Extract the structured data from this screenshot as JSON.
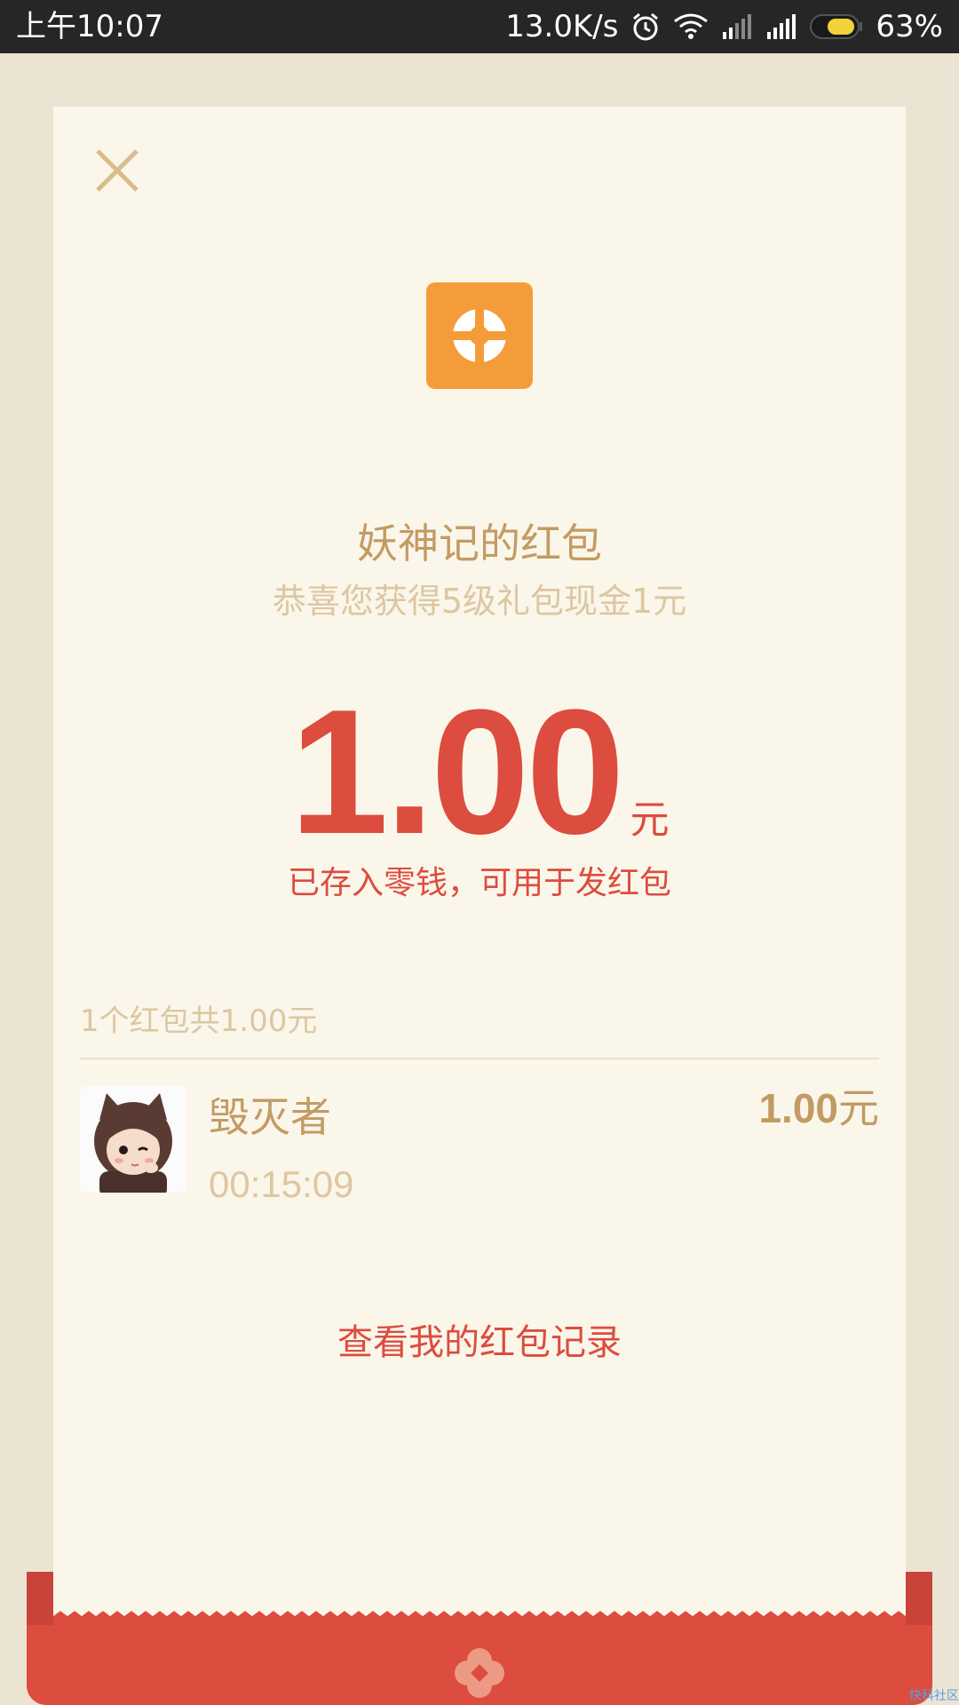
{
  "status_bar": {
    "time": "上午10:07",
    "network_speed": "13.0K/s",
    "battery": "63%",
    "icons": [
      "alarm-icon",
      "wifi-icon",
      "signal-icon",
      "signal-icon",
      "battery-icon"
    ]
  },
  "packet": {
    "sender_title": "妖神记的红包",
    "greeting": "恭喜您获得5级礼包现金1元",
    "amount": "1.00",
    "amount_unit": "元",
    "saved_note": "已存入零钱，可用于发红包",
    "summary": "1个红包共1.00元",
    "receivers": [
      {
        "name": "毁灭者",
        "time": "00:15:09",
        "amount": "1.00",
        "unit": "元"
      }
    ],
    "record_link": "查看我的红包记录"
  },
  "watermark": "快科社区",
  "colors": {
    "accent_red": "#dc4c3f",
    "gold_text": "#c29b64",
    "light_gold_text": "#dcc7a2",
    "logo_orange": "#f59c3a",
    "card_bg": "#fbf6ea",
    "page_bg": "#ece4d2"
  }
}
